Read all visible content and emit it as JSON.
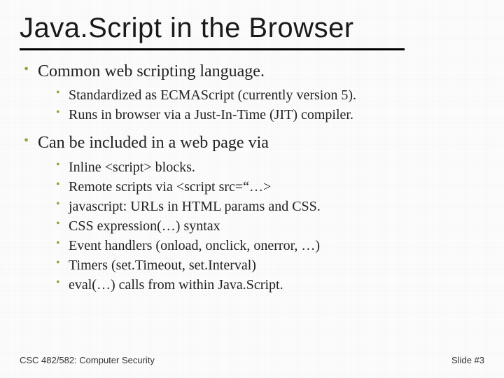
{
  "title": "Java.Script in the Browser",
  "bullets": [
    {
      "text": "Common web scripting language.",
      "sub": [
        "Standardized as ECMAScript (currently version 5).",
        "Runs in browser via a Just-In-Time (JIT) compiler."
      ]
    },
    {
      "text": "Can be included in a web page via",
      "sub": [
        "Inline <script> blocks.",
        "Remote scripts via <script src=“…>",
        "javascript: URLs in HTML params and CSS.",
        "CSS expression(…) syntax",
        "Event handlers (onload, onclick, onerror, …)",
        "Timers (set.Timeout, set.Interval)",
        "eval(…) calls from within Java.Script."
      ]
    }
  ],
  "footer": {
    "left": "CSC 482/582: Computer Security",
    "right": "Slide #3"
  }
}
